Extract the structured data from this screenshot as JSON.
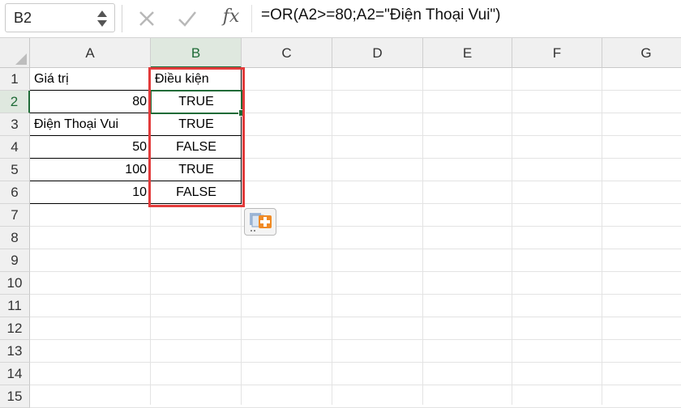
{
  "formula_bar": {
    "name_box": "B2",
    "formula": "=OR(A2>=80;A2=\"Điện Thoại Vui\")",
    "icons": [
      "stepper-icon",
      "cancel-x-icon",
      "enter-check-icon",
      "fx-icon"
    ],
    "fx_label": "fx"
  },
  "columns": [
    "A",
    "B",
    "C",
    "D",
    "E",
    "F",
    "G"
  ],
  "rows": [
    "1",
    "2",
    "3",
    "4",
    "5",
    "6",
    "7",
    "8",
    "9",
    "10",
    "11",
    "12",
    "13",
    "14",
    "15"
  ],
  "selected_cell": "B2",
  "table": {
    "headers": [
      "Giá trị",
      "Điều kiện"
    ],
    "data": [
      [
        "80",
        "TRUE"
      ],
      [
        "Điện Thoại Vui",
        "TRUE"
      ],
      [
        "50",
        "FALSE"
      ],
      [
        "100",
        "TRUE"
      ],
      [
        "10",
        "FALSE"
      ]
    ]
  },
  "colors": {
    "selection": "#1f6b37",
    "highlight": "#e23b3b",
    "paste_icon_accent": "#f08a24"
  },
  "paste_options_icon": "paste-options-icon"
}
